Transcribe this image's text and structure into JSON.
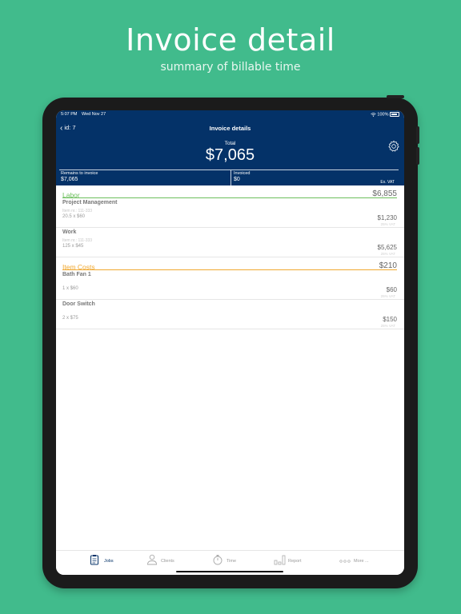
{
  "hero": {
    "title": "Invoice detail",
    "subtitle": "summary of billable time"
  },
  "status_bar": {
    "time": "5:07 PM",
    "date": "Wed Nov 27",
    "battery": "100%"
  },
  "nav": {
    "back_label": "id: 7",
    "title": "Invoice details"
  },
  "summary": {
    "total_label": "Total",
    "total_value": "$7,065",
    "remains_label": "Remains to invoice",
    "remains_value": "$7,065",
    "invoiced_label": "Invoiced",
    "invoiced_value": "$0",
    "ex_vat": "Ex. VAT"
  },
  "sections": [
    {
      "name": "Labor",
      "total": "$6,855",
      "color": "#6cbf5c",
      "items": [
        {
          "title": "Project Management",
          "item_no": "Item nr.: 111-333",
          "qty": "20.5 x $60",
          "amount": "$1,230",
          "vat": "25% VAT"
        },
        {
          "title": "Work",
          "item_no": "Item nr.: 111-333",
          "qty": "125 x $45",
          "amount": "$5,625",
          "vat": "25% VAT"
        }
      ]
    },
    {
      "name": "Item Costs",
      "total": "$210",
      "color": "#f0a830",
      "items": [
        {
          "title": "Bath Fan 1",
          "item_no": "",
          "qty": "1 x $60",
          "amount": "$60",
          "vat": "25% VAT"
        },
        {
          "title": "Door Switch",
          "item_no": "",
          "qty": "2 x $75",
          "amount": "$150",
          "vat": "25% VAT"
        }
      ]
    }
  ],
  "tabs": [
    {
      "label": "Jobs",
      "icon": "clipboard-icon"
    },
    {
      "label": "Clients",
      "icon": "person-icon"
    },
    {
      "label": "Time",
      "icon": "stopwatch-icon"
    },
    {
      "label": "Report",
      "icon": "bar-chart-icon"
    },
    {
      "label": "More ...",
      "icon": "more-dots-icon"
    }
  ]
}
